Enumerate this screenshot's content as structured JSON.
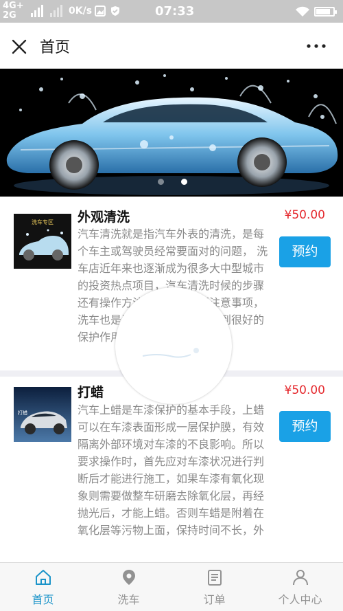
{
  "status_bar": {
    "network_top": "4G+",
    "network_bottom": "2G",
    "speed": "0K/s",
    "time": "07:33",
    "battery_level": 0.85
  },
  "nav": {
    "title": "首页"
  },
  "banner": {
    "slide_count": 2,
    "active_slide": 2
  },
  "services": [
    {
      "name": "外观清洗",
      "price": "¥50.00",
      "description": "汽车清洗就是指汽车外表的清洗，是每个车主或驾驶员经常要面对的问题， 洗车店近年来也逐渐成为很多大中型城市的投资热点项目，汽车清洗时候的步骤还有操作方法以及其中重要注意事项，洗车也是汽车养护，让汽车起到很好的保护作用。",
      "button_label": "预约",
      "thumb_text": "洗车专区"
    },
    {
      "name": "打蜡",
      "price": "¥50.00",
      "description": "汽车上蜡是车漆保护的基本手段，上蜡可以在车漆表面形成一层保护膜，有效隔离外部环境对车漆的不良影响。所以要求操作时，首先应对车漆状况进行判断后才能进行施工，如果车漆有氧化现象则需要做整车研磨去除氧化层，再经抛光后，才能上蜡。否则车蜡是附着在氧化层等污物上面，保持时间不长，外",
      "button_label": "预约",
      "thumb_text": "打蜡"
    }
  ],
  "tabbar": {
    "items": [
      {
        "label": "首页",
        "icon": "home-icon",
        "active": true
      },
      {
        "label": "洗车",
        "icon": "location-pin-icon",
        "active": false
      },
      {
        "label": "订单",
        "icon": "order-list-icon",
        "active": false
      },
      {
        "label": "个人中心",
        "icon": "user-icon",
        "active": false
      }
    ]
  },
  "colors": {
    "accent": "#1aa1e6",
    "price": "#e5292e",
    "tab_active": "#1b94c9",
    "status_bar": "#c7c7c7"
  }
}
